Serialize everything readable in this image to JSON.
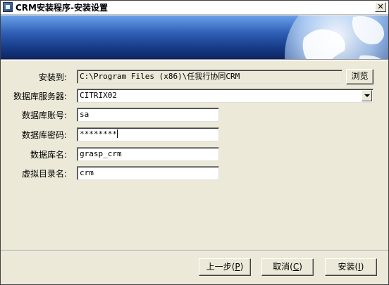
{
  "window": {
    "title": "CRM安装程序-安装设置"
  },
  "form": {
    "install_path": {
      "label": "安装到:",
      "value": "C:\\Program Files (x86)\\任我行协同CRM",
      "browse_label": "浏览"
    },
    "db_server": {
      "label": "数据库服务器:",
      "value": "CITRIX02"
    },
    "db_user": {
      "label": "数据库账号:",
      "value": "sa"
    },
    "db_password": {
      "label": "数据库密码:",
      "value": "********"
    },
    "db_name": {
      "label": "数据库名:",
      "value": "grasp_crm"
    },
    "virtual_dir": {
      "label": "虚拟目录名:",
      "value": "crm"
    }
  },
  "footer": {
    "prev": {
      "label": "上一步",
      "key": "P"
    },
    "cancel": {
      "label": "取消",
      "key": "C"
    },
    "install": {
      "label": "安装",
      "key": "I"
    }
  },
  "icons": {
    "app": "installer-icon",
    "close": "close-icon",
    "dropdown": "chevron-down-icon"
  },
  "colors": {
    "banner_dark": "#0d2562",
    "banner_light": "#6aa0ea",
    "dialog_bg": "#ece9d8"
  }
}
